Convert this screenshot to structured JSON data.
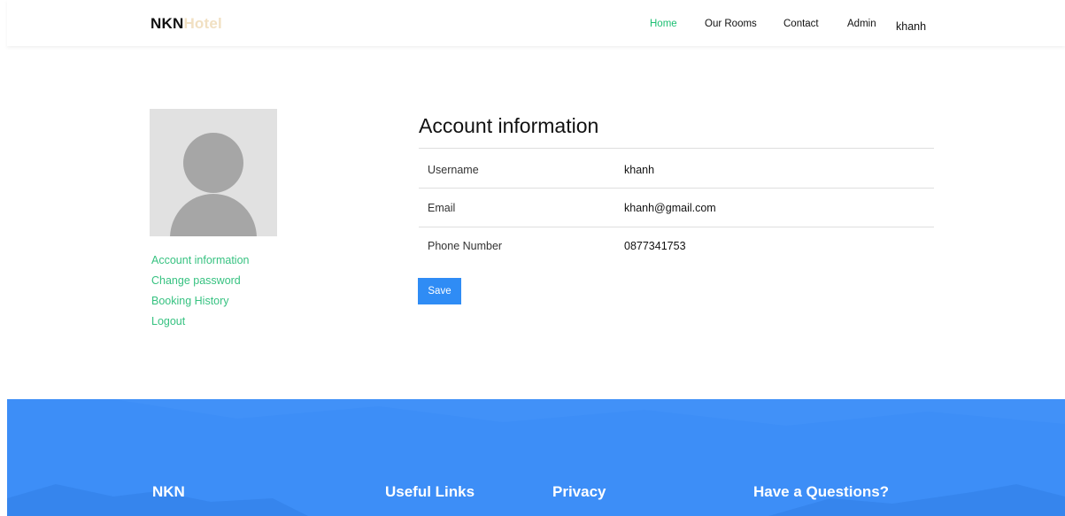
{
  "brand": {
    "part1": "NKN",
    "part2": "Hotel"
  },
  "nav": {
    "home": "Home",
    "rooms": "Our Rooms",
    "contact": "Contact",
    "admin": "Admin",
    "user": "khanh"
  },
  "sidebar": {
    "items": [
      {
        "label": "Account information"
      },
      {
        "label": "Change password"
      },
      {
        "label": "Booking History"
      },
      {
        "label": "Logout"
      }
    ]
  },
  "account": {
    "title": "Account information",
    "rows": [
      {
        "label": "Username",
        "value": "khanh"
      },
      {
        "label": "Email",
        "value": "khanh@gmail.com"
      },
      {
        "label": "Phone Number",
        "value": "0877341753"
      }
    ],
    "save_label": "Save"
  },
  "footer": {
    "headings": [
      "NKN",
      "Useful Links",
      "Privacy",
      "Have a Questions?"
    ]
  },
  "colors": {
    "accent_green": "#1dbf73",
    "link_green": "#37c281",
    "primary_blue": "#2f8cf5",
    "footer_blue": "#3d8ef7",
    "brand_cream": "#f1e0c2"
  },
  "icons": {
    "avatar": "user-silhouette-icon"
  }
}
